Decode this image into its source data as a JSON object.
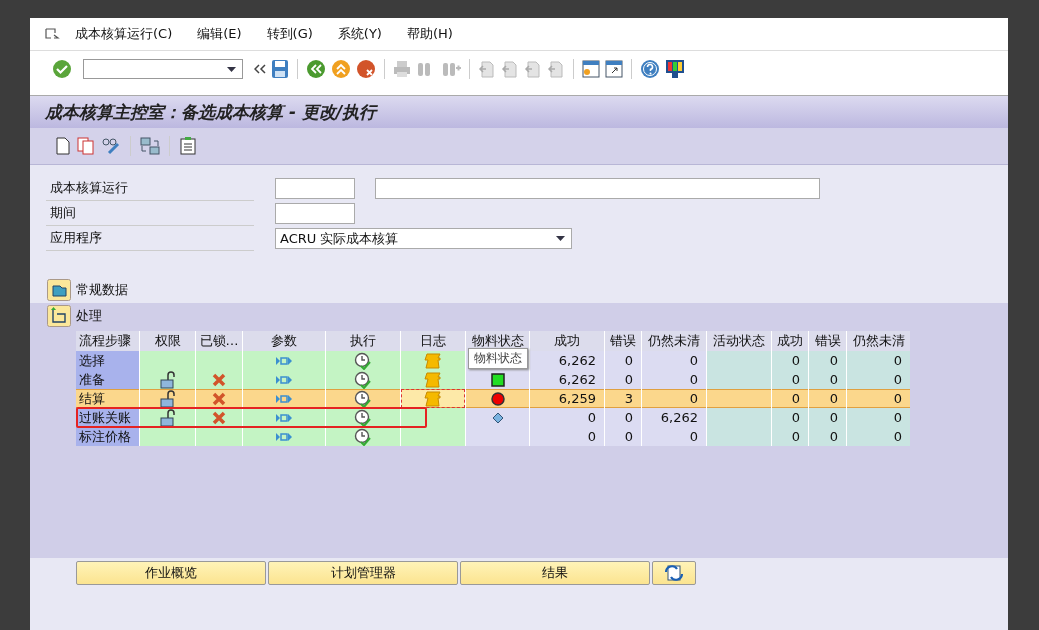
{
  "menu": [
    {
      "label": "成本核算运行(C)"
    },
    {
      "label": "编辑(E)"
    },
    {
      "label": "转到(G)"
    },
    {
      "label": "系统(Y)"
    },
    {
      "label": "帮助(H)"
    }
  ],
  "title": "成本核算主控室：备选成本核算 - 更改/执行",
  "form": [
    {
      "label": "成本核算运行",
      "kind": "pair"
    },
    {
      "label": "期间",
      "kind": "short"
    },
    {
      "label": "应用程序",
      "kind": "dropdown",
      "value": "ACRU 实际成本核算"
    }
  ],
  "sections": [
    {
      "label": "常规数据",
      "expanded": false
    },
    {
      "label": "处理",
      "expanded": true
    }
  ],
  "table": {
    "columns": [
      "流程步骤",
      "权限",
      "已锁…",
      "参数",
      "执行",
      "日志",
      "物料状态",
      "成功",
      "错误",
      "仍然未清",
      "活动状态",
      "成功",
      "错误",
      "仍然未清"
    ],
    "tooltip": "物料状态",
    "rows": [
      {
        "step": "选择",
        "auth": false,
        "locked": false,
        "log": true,
        "selected": false,
        "marked": false,
        "counts": [
          "6,262",
          "0",
          "0"
        ],
        "activity_counts": [
          "0",
          "0",
          "0"
        ]
      },
      {
        "step": "准备",
        "auth": true,
        "locked": true,
        "log": true,
        "material": {
          "kind": "ok"
        },
        "selected": false,
        "marked": false,
        "counts": [
          "6,262",
          "0",
          "0"
        ],
        "activity_counts": [
          "0",
          "0",
          "0"
        ]
      },
      {
        "step": "结算",
        "auth": true,
        "locked": true,
        "log": true,
        "material": {
          "kind": "error"
        },
        "selected": true,
        "marked": false,
        "counts": [
          "6,259",
          "3",
          "0"
        ],
        "activity_counts": [
          "0",
          "0",
          "0"
        ]
      },
      {
        "step": "过账关账",
        "auth": true,
        "locked": true,
        "log": false,
        "material": {
          "kind": "pending"
        },
        "selected": false,
        "marked": true,
        "counts": [
          "0",
          "0",
          "6,262"
        ],
        "activity_counts": [
          "0",
          "0",
          "0"
        ]
      },
      {
        "step": "标注价格",
        "auth": false,
        "locked": false,
        "log": false,
        "selected": false,
        "marked": false,
        "counts": [
          "0",
          "0",
          "0"
        ],
        "activity_counts": [
          "0",
          "0",
          "0"
        ]
      }
    ]
  },
  "buttons": [
    "作业概览",
    "计划管理器",
    "结果"
  ]
}
